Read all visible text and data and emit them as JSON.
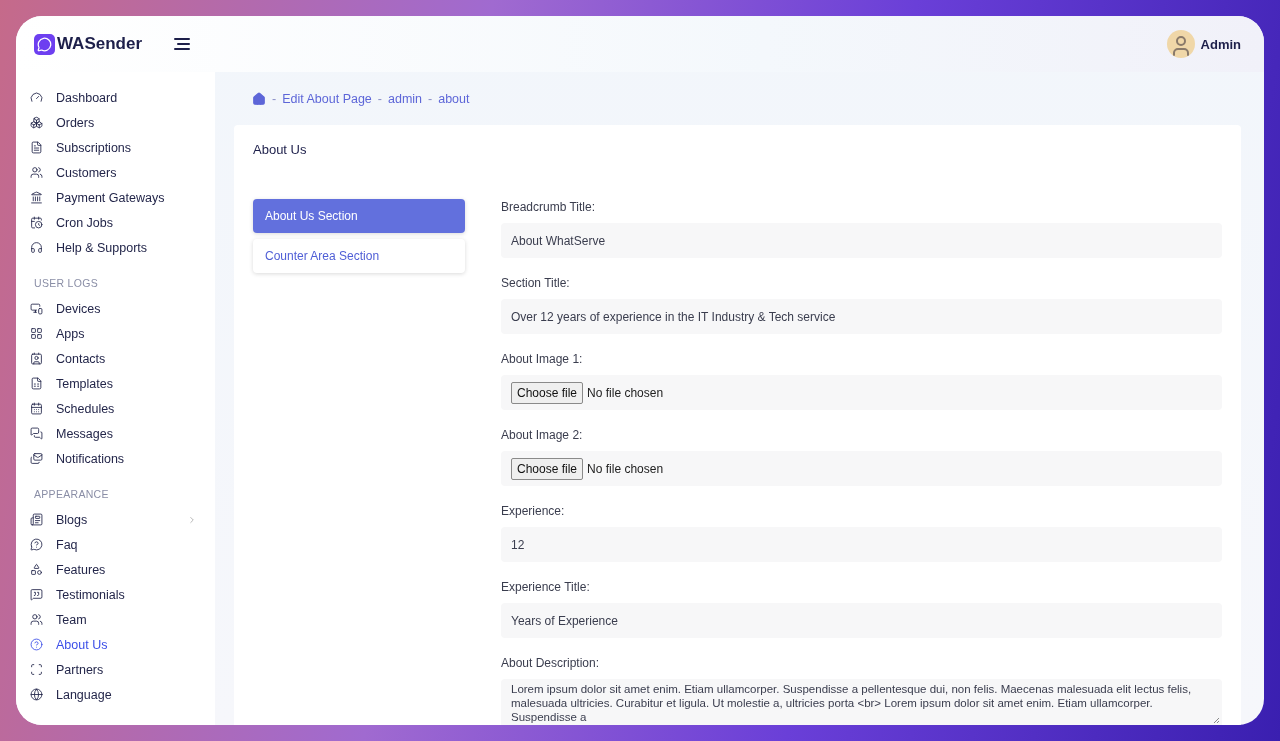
{
  "brand": {
    "name": "WASender"
  },
  "user": {
    "name": "Admin"
  },
  "sidebar": {
    "sections": [
      {
        "items": [
          {
            "label": "Dashboard",
            "selected": false
          },
          {
            "label": "Orders",
            "selected": false
          },
          {
            "label": "Subscriptions",
            "selected": false
          },
          {
            "label": "Customers",
            "selected": false
          },
          {
            "label": "Payment Gateways",
            "selected": false
          },
          {
            "label": "Cron Jobs",
            "selected": false
          },
          {
            "label": "Help & Supports",
            "selected": false
          }
        ]
      },
      {
        "heading": "USER LOGS",
        "items": [
          {
            "label": "Devices",
            "selected": false
          },
          {
            "label": "Apps",
            "selected": false
          },
          {
            "label": "Contacts",
            "selected": false
          },
          {
            "label": "Templates",
            "selected": false
          },
          {
            "label": "Schedules",
            "selected": false
          },
          {
            "label": "Messages",
            "selected": false
          },
          {
            "label": "Notifications",
            "selected": false
          }
        ]
      },
      {
        "heading": "APPEARANCE",
        "items": [
          {
            "label": "Blogs",
            "selected": false,
            "has_submenu": true
          },
          {
            "label": "Faq",
            "selected": false
          },
          {
            "label": "Features",
            "selected": false
          },
          {
            "label": "Testimonials",
            "selected": false
          },
          {
            "label": "Team",
            "selected": false
          },
          {
            "label": "About Us",
            "selected": true
          },
          {
            "label": "Partners",
            "selected": false
          },
          {
            "label": "Language",
            "selected": false
          }
        ]
      }
    ]
  },
  "breadcrumb": {
    "separator": "-",
    "items": [
      "Edit About Page",
      "admin",
      "about"
    ]
  },
  "card": {
    "title": "About Us",
    "tabs": [
      {
        "label": "About Us Section",
        "selected": true
      },
      {
        "label": "Counter Area Section",
        "selected": false
      }
    ],
    "fields": [
      {
        "kind": "text",
        "label": "Breadcrumb Title:",
        "value": "About WhatServe"
      },
      {
        "kind": "text",
        "label": "Section Title:",
        "value": "Over 12 years of experience in the IT Industry & Tech service"
      },
      {
        "kind": "file",
        "label": "About Image 1:",
        "button": "Choose file",
        "status": "No file chosen"
      },
      {
        "kind": "file",
        "label": "About Image 2:",
        "button": "Choose file",
        "status": "No file chosen"
      },
      {
        "kind": "text",
        "label": "Experience:",
        "value": "12"
      },
      {
        "kind": "text",
        "label": "Experience Title:",
        "value": "Years of Experience"
      },
      {
        "kind": "textarea",
        "label": "About Description:",
        "value": "Lorem ipsum dolor sit amet enim. Etiam ullamcorper. Suspendisse a pellentesque dui, non felis. Maecenas malesuada elit lectus felis, malesuada ultricies. Curabitur et ligula. Ut molestie a, ultricies porta <br> Lorem ipsum dolor sit amet enim. Etiam ullamcorper. Suspendisse a"
      }
    ]
  }
}
